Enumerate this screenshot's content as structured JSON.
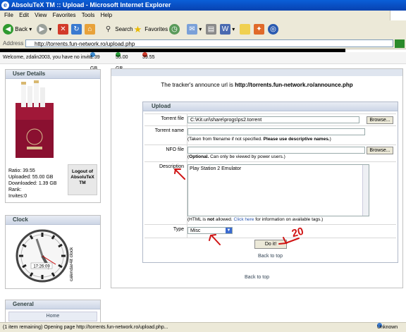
{
  "window": {
    "title": "AbsoluTeX TM :: Upload - Microsoft Internet Explorer"
  },
  "menu": [
    "File",
    "Edit",
    "View",
    "Favorites",
    "Tools",
    "Help"
  ],
  "toolbar": {
    "back": "Back",
    "search": "Search",
    "favorites": "Favorites"
  },
  "address": {
    "label": "Address",
    "url": "http://torrents.fun-network.ro/upload.php"
  },
  "welcome": {
    "text": "Welcome, zdalin2003, you have no invite",
    "uploaded": "1.39 GB",
    "downloaded": "55.00 GB",
    "ratio": "39.55"
  },
  "user_details": {
    "title": "User Details",
    "ratio_label": "Ratio:",
    "ratio": "39.55",
    "uploaded_label": "Uploaded:",
    "uploaded": "55.00 GB",
    "downloaded_label": "Downloaded:",
    "downloaded": "1.39 GB",
    "rank_label": "Rank:",
    "rank": "",
    "invites_label": "Invites:",
    "invites": "0",
    "logout": "Logout of AbsoluTeX TM"
  },
  "clock": {
    "title": "Clock",
    "time": "17:26:09",
    "side_text": "calendar4it clock"
  },
  "general": {
    "title": "General",
    "home": "Home"
  },
  "main": {
    "announce_prefix": "The tracker's announce url is ",
    "announce_url": "http://torrents.fun-network.ro/announce.php",
    "upload_title": "Upload",
    "torrent_file_label": "Torrent file",
    "torrent_file_value": "C:\\Kit.uri\\share\\progs\\ps2.torrent",
    "browse": "Browse...",
    "torrent_name_label": "Torrent name",
    "torrent_name_note_1": "(Taken from filename if not specified. ",
    "torrent_name_note_2": "Please use descriptive names.",
    "torrent_name_note_3": ")",
    "nfo_label": "NFO file",
    "nfo_note_1": "(",
    "nfo_note_bold": "Optional.",
    "nfo_note_2": " Can only be viewed by power users.)",
    "description_label": "Description",
    "description_value": "Play Station 2 Emulator",
    "html_note_1": "(HTML is ",
    "html_note_bold": "not",
    "html_note_2": " allowed. ",
    "html_note_link": "Click here",
    "html_note_3": " for information on available tags.)",
    "type_label": "Type",
    "type_value": "Misc",
    "submit": "Do it!",
    "back_to_top": "Back to top"
  },
  "annotations": {
    "number": "20",
    "color": "#d01414"
  },
  "status": {
    "text": "(1 item remaining) Opening page http://torrents.fun-network.ro/upload.php...",
    "zone": "Unknown"
  }
}
